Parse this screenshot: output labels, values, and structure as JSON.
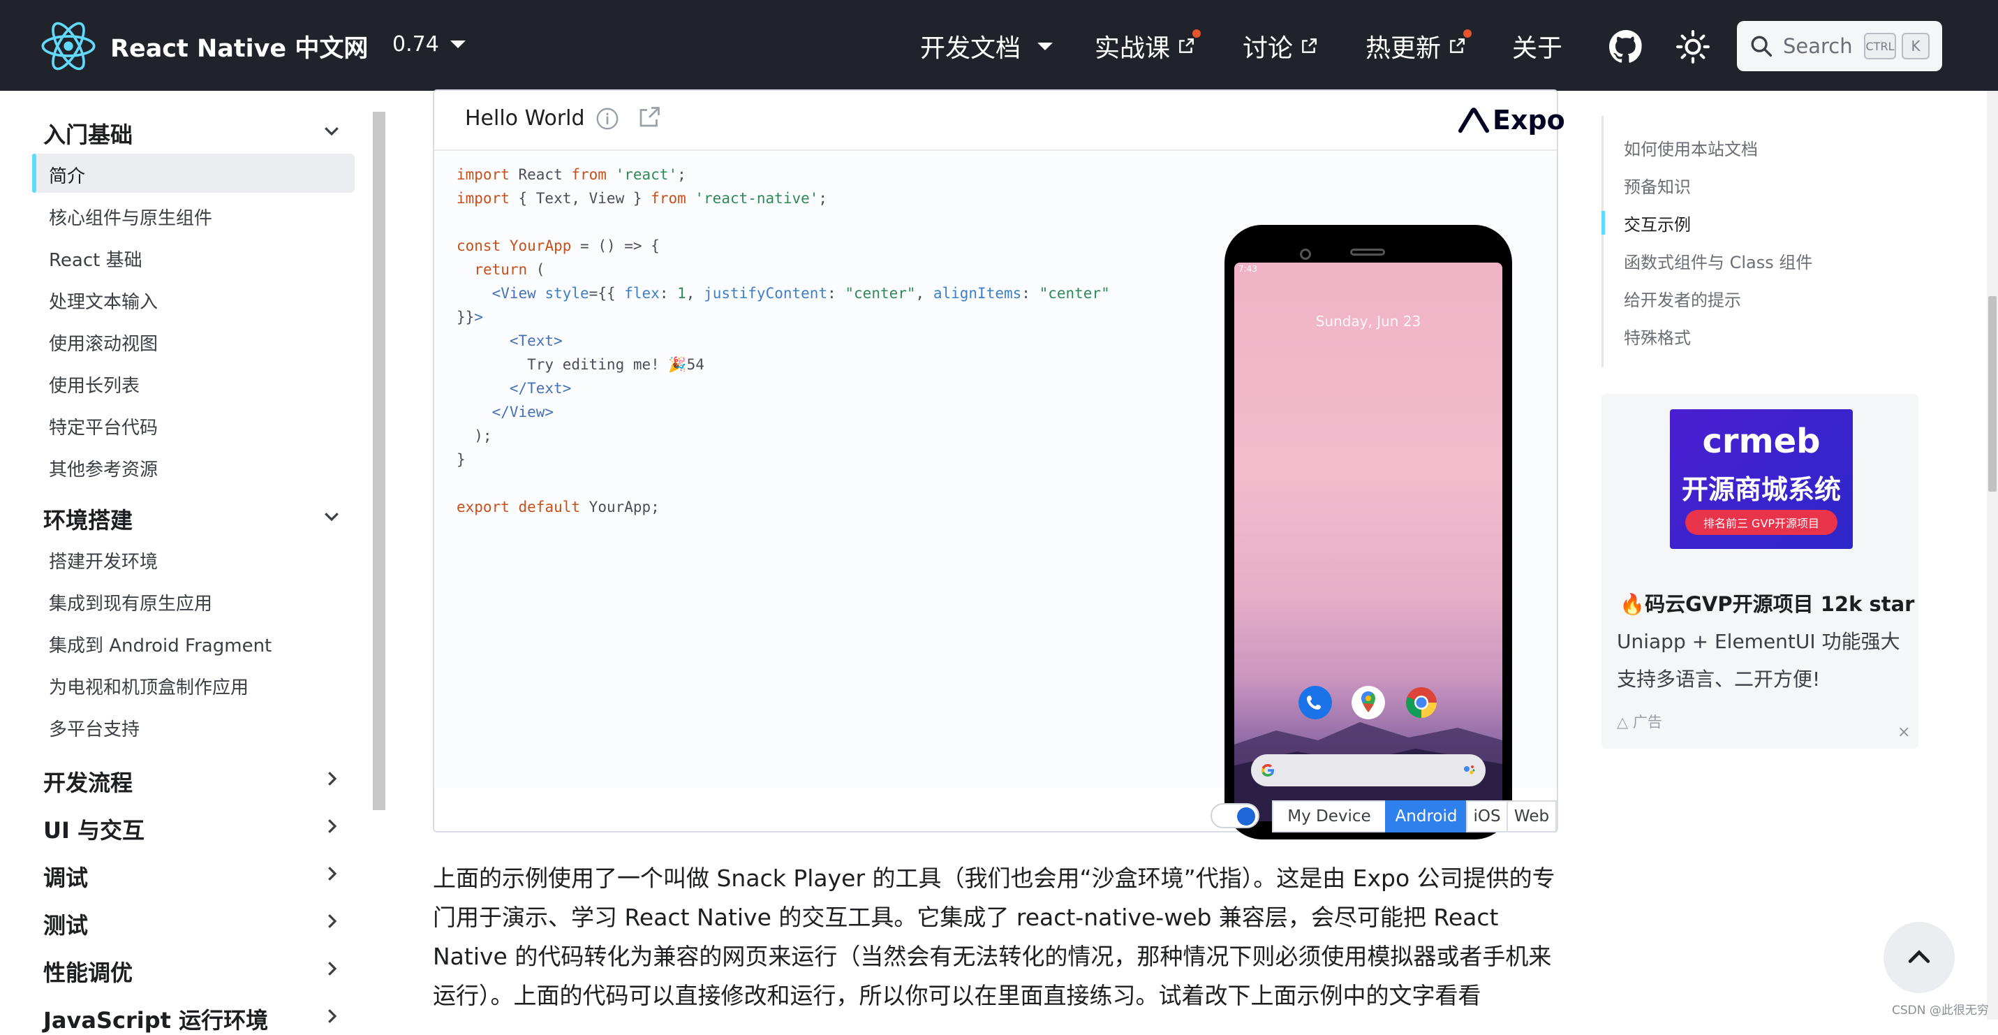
{
  "navbar": {
    "brand": "React Native 中文网",
    "version": "0.74",
    "links": [
      {
        "label": "开发文档",
        "dropdown": true
      },
      {
        "label": "实战课",
        "external": true,
        "dot": true
      },
      {
        "label": "讨论",
        "external": true
      },
      {
        "label": "热更新",
        "external": true,
        "dot": true
      },
      {
        "label": "关于"
      }
    ],
    "search": {
      "label": "Search",
      "key1": "CTRL",
      "key2": "K"
    },
    "icons": {
      "github": "github-icon",
      "theme": "sun-icon"
    }
  },
  "sidebar": {
    "sections": [
      {
        "title": "入门基础",
        "expanded": true,
        "items": [
          "简介",
          "核心组件与原生组件",
          "React 基础",
          "处理文本输入",
          "使用滚动视图",
          "使用长列表",
          "特定平台代码",
          "其他参考资源"
        ]
      },
      {
        "title": "环境搭建",
        "expanded": true,
        "items": [
          "搭建开发环境",
          "集成到现有原生应用",
          "集成到 Android Fragment",
          "为电视和机顶盒制作应用",
          "多平台支持"
        ]
      },
      {
        "title": "开发流程",
        "expanded": false
      },
      {
        "title": "UI 与交互",
        "expanded": false
      },
      {
        "title": "调试",
        "expanded": false
      },
      {
        "title": "测试",
        "expanded": false
      },
      {
        "title": "性能调优",
        "expanded": false
      },
      {
        "title": "JavaScript 运行环境",
        "expanded": false
      }
    ],
    "active_item": "简介"
  },
  "snack": {
    "title": "Hello World",
    "brand": "Expo",
    "code": [
      "import React from 'react';",
      "import { Text, View } from 'react-native';",
      "",
      "const YourApp = () => {",
      "  return (",
      "    <View style={{ flex: 1, justifyContent: \"center\", alignItems: \"center\"",
      "}}>",
      "      <Text>",
      "        Try editing me! 🎉54",
      "      </Text>",
      "    </View>",
      "  );",
      "}",
      "",
      "export default YourApp;"
    ],
    "phone": {
      "time": "7:43",
      "date": "Sunday, Jun 23"
    },
    "platforms": [
      "My Device",
      "Android",
      "iOS",
      "Web"
    ],
    "active_platform": "Android"
  },
  "paragraph": "上面的示例使用了一个叫做 Snack Player 的工具（我们也会用“沙盒环境”代指）。这是由 Expo 公司提供的专门用于演示、学习 React Native 的交互工具。它集成了 react-native-web 兼容层，会尽可能把 React Native 的代码转化为兼容的网页来运行（当然会有无法转化的情况，那种情况下则必须使用模拟器或者手机来运行）。上面的代码可以直接修改和运行，所以你可以在里面直接练习。试着改下上面示例中的文字看看",
  "toc": {
    "items": [
      "如何使用本站文档",
      "预备知识",
      "交互示例",
      "函数式组件与 Class 组件",
      "给开发者的提示",
      "特殊格式"
    ],
    "active": "交互示例"
  },
  "ad": {
    "logo": "crmeb",
    "slogan": "开源商城系统",
    "badge": "排名前三 GVP开源项目",
    "title": "码云GVP开源项目 12k star",
    "desc": "Uniapp + ElementUI 功能强大 支持多语言、二开方便!",
    "label": "广告",
    "close": "×"
  },
  "watermark": "CSDN @此很无穷",
  "colors": {
    "navbar": "#20232a",
    "accent": "#61dafb",
    "active_platform": "#2f80ed"
  }
}
